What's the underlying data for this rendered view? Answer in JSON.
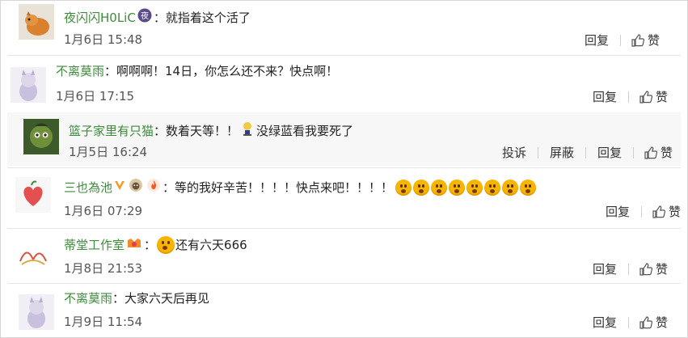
{
  "actions": {
    "reply": "回复",
    "like": "赞",
    "report": "投诉",
    "block": "屏蔽"
  },
  "comments": [
    {
      "user": "夜闪闪H0LiC",
      "badge_text": "夜",
      "text": "：就指着这个活了",
      "time": "1月6日 15:48"
    },
    {
      "user": "不离莫雨",
      "text": "：啊啊啊！14日，你怎么还不来？快点啊！",
      "time": "1月6日 17:15"
    },
    {
      "user": "篮子家里有只猫",
      "text": "：数着天等！！",
      "text2": "没绿蓝看我要死了",
      "time": "1月5日 16:24"
    },
    {
      "user": "三也為池",
      "text": "：等的我好辛苦！！！！快点来吧！！！！",
      "time": "1月6日 07:29"
    },
    {
      "user": "蒂堂工作室",
      "text": "：",
      "text2": "还有六天666",
      "time": "1月8日 21:53"
    },
    {
      "user": "不离莫雨",
      "text": "：大家六天后再见",
      "time": "1月9日 11:54"
    }
  ],
  "colors": {
    "username": "#3d8b3b",
    "separator": "#e6e6e6",
    "time": "#555555"
  }
}
